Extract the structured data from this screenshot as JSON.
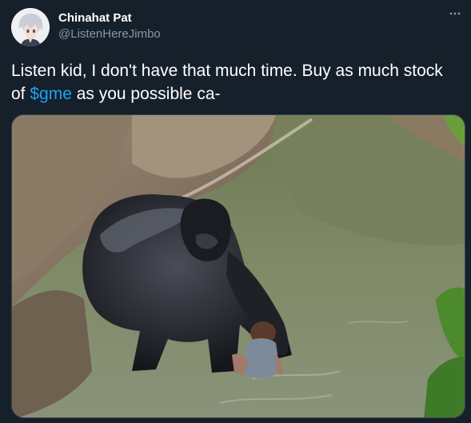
{
  "author": {
    "display_name": "Chinahat Pat",
    "handle": "@ListenHereJimbo"
  },
  "tweet": {
    "text_before": "Listen kid, I don't have that much time. Buy as much stock of ",
    "cashtag": "$gme",
    "text_after": " as you possible ca-"
  },
  "icons": {
    "more": "more-horizontal-icon",
    "avatar": "anime-avatar"
  },
  "colors": {
    "background": "#15202b",
    "link": "#1da1f2",
    "secondary_text": "#8899a6"
  }
}
